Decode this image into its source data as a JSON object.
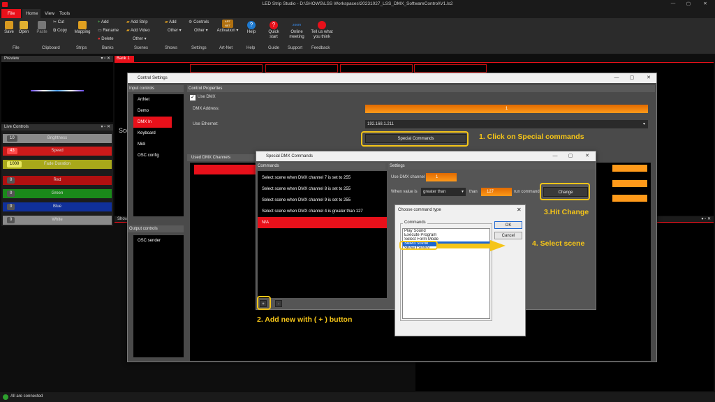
{
  "app": {
    "title": "LED Strip Studio - D:\\SHOWS\\LSS Workspaces\\20231027_LSS_DMX_SoftwareControl\\V1.ls2"
  },
  "menu": {
    "file": "File",
    "home": "Home",
    "view": "View",
    "tools": "Tools"
  },
  "ribbon": {
    "save": "Save",
    "open": "Open",
    "paste": "Paste",
    "cut": "Cut",
    "copy": "Copy",
    "mapping": "Mapping",
    "add_bank": "Add",
    "rename": "Rename",
    "delete": "Delete",
    "add_strip": "Add Strip",
    "add_video": "Add Video",
    "other_scenes": "Other",
    "add_show": "Add",
    "other_shows": "Other",
    "controls": "Controls",
    "other_settings": "Other",
    "activation": "Activation",
    "artnet_logo": "ART NET",
    "help": "Help",
    "quick_start": "Quick start",
    "online_meeting": "Online meeting",
    "zoom": "zoom",
    "tell_us": "Tell us what you think",
    "groups": {
      "file": "File",
      "clipboard": "Clipboard",
      "strips": "Strips",
      "banks": "Banks",
      "scenes": "Scenes",
      "shows": "Shows",
      "settings": "Settings",
      "artnet": "Art-Net",
      "help": "Help",
      "guide": "Guide",
      "support": "Support",
      "feedback": "Feedback"
    }
  },
  "preview": {
    "title": "Preview"
  },
  "bank": {
    "tab": "Bank 1"
  },
  "live_controls": {
    "title": "Live Controls",
    "items": [
      {
        "label": "Brightness",
        "value": "10",
        "color": "#8a8a8a"
      },
      {
        "label": "Speed",
        "value": "43",
        "color": "#cc1a1a"
      },
      {
        "label": "Fade Duration",
        "value": "1000",
        "color": "#a8a81a"
      },
      {
        "label": "Red",
        "value": "0",
        "color": "#b01010"
      },
      {
        "label": "Green",
        "value": "0",
        "color": "#1a8a1a"
      },
      {
        "label": "Blue",
        "value": "0",
        "color": "#10309a"
      },
      {
        "label": "White",
        "value": "0",
        "color": "#8a8a8a"
      }
    ]
  },
  "shows_tab": "Shows",
  "scene_label_stub": "Sce",
  "control_settings": {
    "title": "Control Settings",
    "input_controls": "Input controls",
    "inputs": [
      "ArtNet",
      "Demo",
      "DMX In",
      "Keyboard",
      "Midi",
      "OSC config"
    ],
    "output_controls": "Output controls",
    "outputs": [
      "OSC sender"
    ],
    "control_properties": "Control Properties",
    "use_dmx": "Use DMX",
    "dmx_address_label": "DMX Address:",
    "dmx_address": "1",
    "use_ethernet_label": "Use Ethernet:",
    "ethernet_ip": "192.168.1.211",
    "special_commands": "Special Commands",
    "used_dmx_channels": "Used DMX Channels"
  },
  "special_dmx": {
    "title": "Special DMX Commands",
    "commands_header": "Commands",
    "settings_header": "Settings",
    "commands": [
      "Select scene when DMX channel 7 is set to 255",
      "Select scene when DMX channel 8 is set to 255",
      "Select scene when DMX channel 9 is set to 255",
      "Select scene when DMX channel 4 is greater than 127",
      "N/A"
    ],
    "use_dmx_channel_label": "Use DMX channel",
    "use_dmx_channel": "1",
    "when_value_label": "When value is",
    "condition": "greater than",
    "than_label": "than",
    "threshold": "127",
    "run_command_label": "run command",
    "change": "Change",
    "add_btn": "+",
    "remove_btn": "-"
  },
  "choose_cmd": {
    "title": "Choose command type",
    "commands_header": "Commands",
    "options": [
      "Play Sound",
      "Execute Program",
      "Select Form Mode",
      "Select scene",
      "Show Control"
    ],
    "selected": "Select scene",
    "ok": "OK",
    "cancel": "Cancel"
  },
  "annotations": {
    "step1": "1. Click on Special commands",
    "step2": "2. Add new with ( + ) button",
    "step3": "3.Hit Change",
    "step4": "4. Select scene"
  },
  "status": {
    "text": "All are connected"
  },
  "colors": {
    "accent": "#e8101a",
    "highlight": "#f5c518",
    "dmx_orange": "#ff8c1a",
    "selected_blue": "#1e66d0"
  }
}
